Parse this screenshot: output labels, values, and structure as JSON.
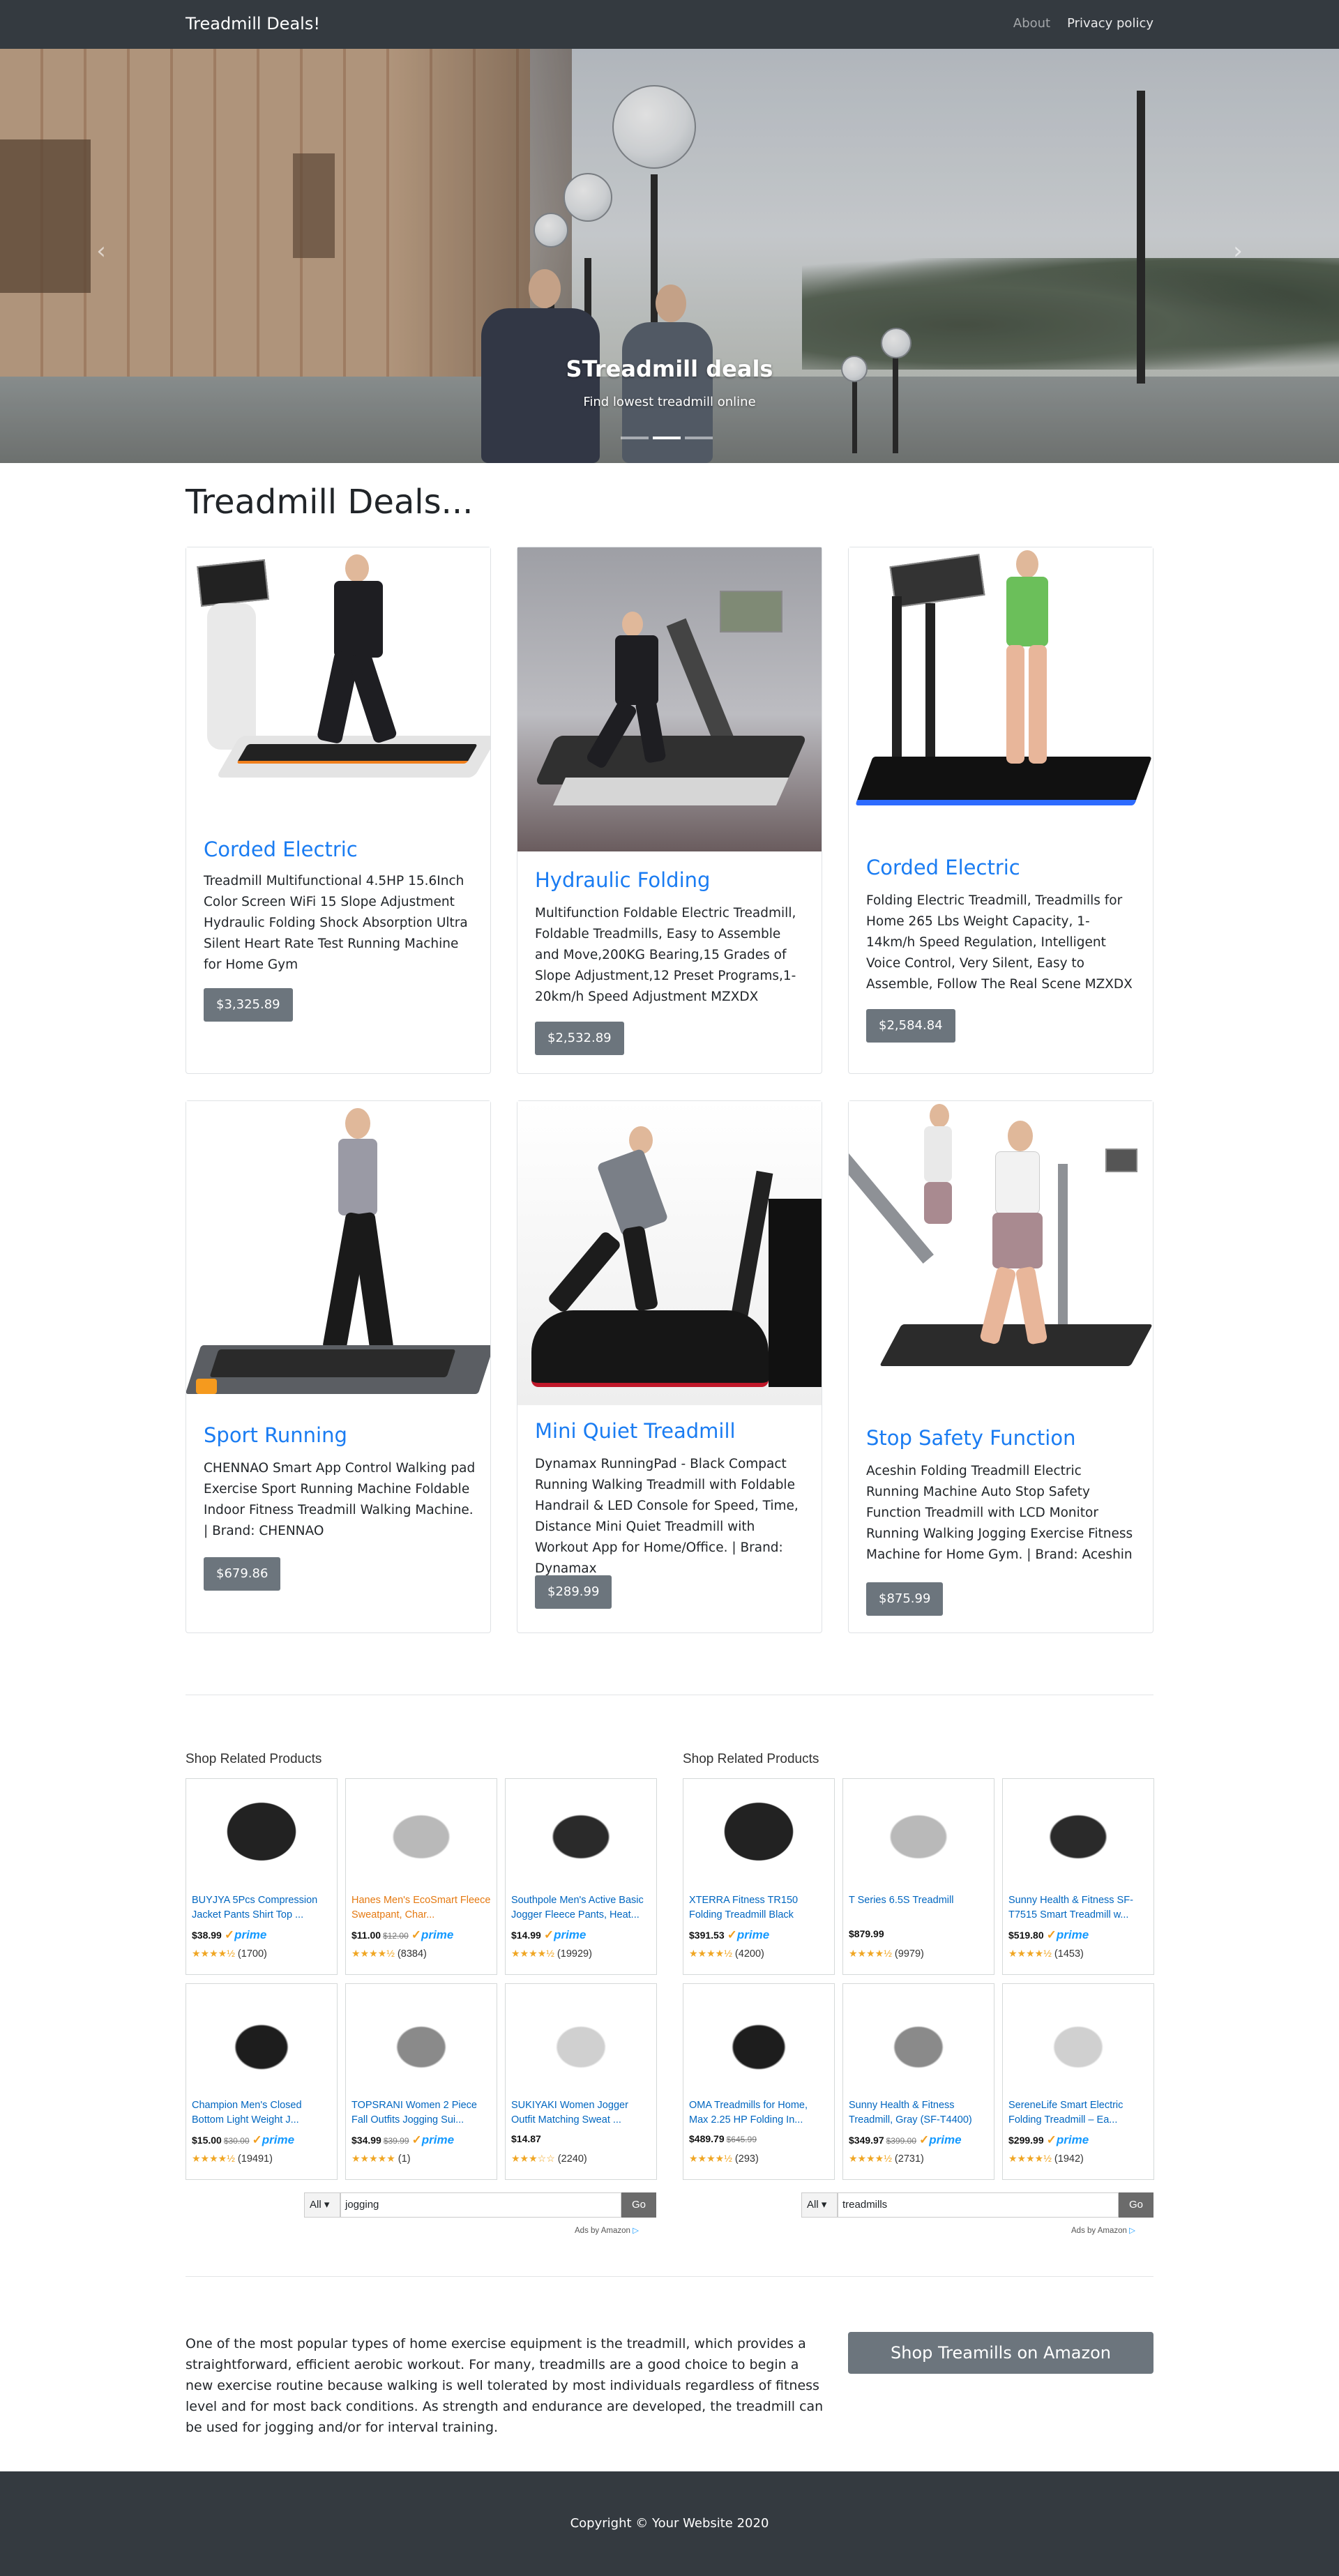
{
  "navbar": {
    "brand": "Treadmill Deals!",
    "links": [
      {
        "label": "About",
        "active": false
      },
      {
        "label": "Privacy policy",
        "active": true
      }
    ]
  },
  "hero": {
    "title": "STreadmill deals",
    "subtitle": "Find lowest treadmill online",
    "prev_icon": "chevron-left-icon",
    "next_icon": "chevron-right-icon",
    "slides": 3,
    "active_slide": 2
  },
  "page_heading": "Treadmill Deals...",
  "products": [
    {
      "title": "Corded Electric",
      "description": "Treadmill Multifunctional 4.5HP 15.6Inch Color Screen WiFi 15 Slope Adjustment Hydraulic Folding Shock Absorption Ultra Silent Heart Rate Test Running Machine for Home Gym",
      "price": "$3,325.89"
    },
    {
      "title": "Hydraulic Folding",
      "description": "Multifunction Foldable Electric Treadmill, Foldable Treadmills, Easy to Assemble and Move,200KG Bearing,15 Grades of Slope Adjustment,12 Preset Programs,1-20km/h Speed Adjustment MZXDX",
      "price": "$2,532.89"
    },
    {
      "title": "Corded Electric",
      "description": "Folding Electric Treadmill, Treadmills for Home 265 Lbs Weight Capacity, 1-14km/h Speed Regulation, Intelligent Voice Control, Very Silent, Easy to Assemble, Follow The Real Scene MZXDX",
      "price": "$2,584.84"
    },
    {
      "title": "Sport Running",
      "description": "CHENNAO Smart App Control Walking pad Exercise Sport Running Machine Foldable Indoor Fitness Treadmill Walking Machine. | Brand: CHENNAO",
      "price": "$679.86"
    },
    {
      "title": "Mini Quiet Treadmill",
      "description": "Dynamax RunningPad - Black Compact Running Walking Treadmill with Foldable Handrail & LED Console for Speed, Time, Distance Mini Quiet Treadmill with Workout App for Home/Office. | Brand: Dynamax",
      "price": "$289.99"
    },
    {
      "title": "Stop Safety Function",
      "description": "Aceshin Folding Treadmill Electric Running Machine Auto Stop Safety Function Treadmill with LCD Monitor Running Walking Jogging Exercise Fitness Machine for Home Gym. | Brand: Aceshin",
      "price": "$875.99"
    }
  ],
  "amazon_left": {
    "title": "Shop Related Products",
    "items": [
      {
        "name": "BUYJYA 5Pcs Compression Jacket Pants Shirt Top ...",
        "price": "$38.99",
        "old_price": "",
        "prime": true,
        "stars": "★★★★½",
        "count": "(1700)",
        "highlight": false
      },
      {
        "name": "Hanes Men's EcoSmart Fleece Sweatpant, Char...",
        "price": "$11.00",
        "old_price": "$12.00",
        "prime": true,
        "stars": "★★★★½",
        "count": "(8384)",
        "highlight": true
      },
      {
        "name": "Southpole Men's Active Basic Jogger Fleece Pants, Heat...",
        "price": "$14.99",
        "old_price": "",
        "prime": true,
        "stars": "★★★★½",
        "count": "(19929)",
        "highlight": false
      },
      {
        "name": "Champion Men's Closed Bottom Light Weight J...",
        "price": "$15.00",
        "old_price": "$30.00",
        "prime": true,
        "stars": "★★★★½",
        "count": "(19491)",
        "highlight": false
      },
      {
        "name": "TOPSRANI Women 2 Piece Fall Outfits Jogging Sui...",
        "price": "$34.99",
        "old_price": "$39.99",
        "prime": true,
        "stars": "★★★★★",
        "count": "(1)",
        "highlight": false
      },
      {
        "name": "SUKIYAKI Women Jogger Outfit Matching Sweat ...",
        "price": "$14.87",
        "old_price": "",
        "prime": false,
        "stars": "★★★☆☆",
        "count": "(2240)",
        "highlight": false
      }
    ],
    "search_select": "All",
    "search_value": "jogging",
    "go_label": "Go",
    "ads_label": "Ads by Amazon"
  },
  "amazon_right": {
    "title": "Shop Related Products",
    "items": [
      {
        "name": "XTERRA Fitness TR150 Folding Treadmill Black",
        "price": "$391.53",
        "old_price": "",
        "prime": true,
        "stars": "★★★★½",
        "count": "(4200)",
        "highlight": false
      },
      {
        "name": "T Series 6.5S Treadmill",
        "price": "$879.99",
        "old_price": "",
        "prime": false,
        "stars": "★★★★½",
        "count": "(9979)",
        "highlight": false
      },
      {
        "name": "Sunny Health & Fitness SF-T7515 Smart Treadmill w...",
        "price": "$519.80",
        "old_price": "",
        "prime": true,
        "stars": "★★★★½",
        "count": "(1453)",
        "highlight": false
      },
      {
        "name": "OMA Treadmills for Home, Max 2.25 HP Folding In...",
        "price": "$489.79",
        "old_price": "$645.99",
        "prime": false,
        "stars": "★★★★½",
        "count": "(293)",
        "highlight": false
      },
      {
        "name": "Sunny Health & Fitness Treadmill, Gray (SF-T4400)",
        "price": "$349.97",
        "old_price": "$399.00",
        "prime": true,
        "stars": "★★★★½",
        "count": "(2731)",
        "highlight": false
      },
      {
        "name": "SereneLife Smart Electric Folding Treadmill – Ea...",
        "price": "$299.99",
        "old_price": "",
        "prime": true,
        "stars": "★★★★½",
        "count": "(1942)",
        "highlight": false
      }
    ],
    "search_select": "All",
    "search_value": "treadmills",
    "go_label": "Go",
    "ads_label": "Ads by Amazon"
  },
  "about": {
    "text": "One of the most popular types of home exercise equipment is the treadmill, which provides a straightforward, efficient aerobic workout. For many, treadmills are a good choice to begin a new exercise routine because walking is well tolerated by most individuals regardless of fitness level and for most back conditions. As strength and endurance are developed, the treadmill can be used for jogging and/or for interval training.",
    "shop_button": "Shop Treamills on Amazon"
  },
  "footer": {
    "copyright": "Copyright © Your Website 2020"
  }
}
